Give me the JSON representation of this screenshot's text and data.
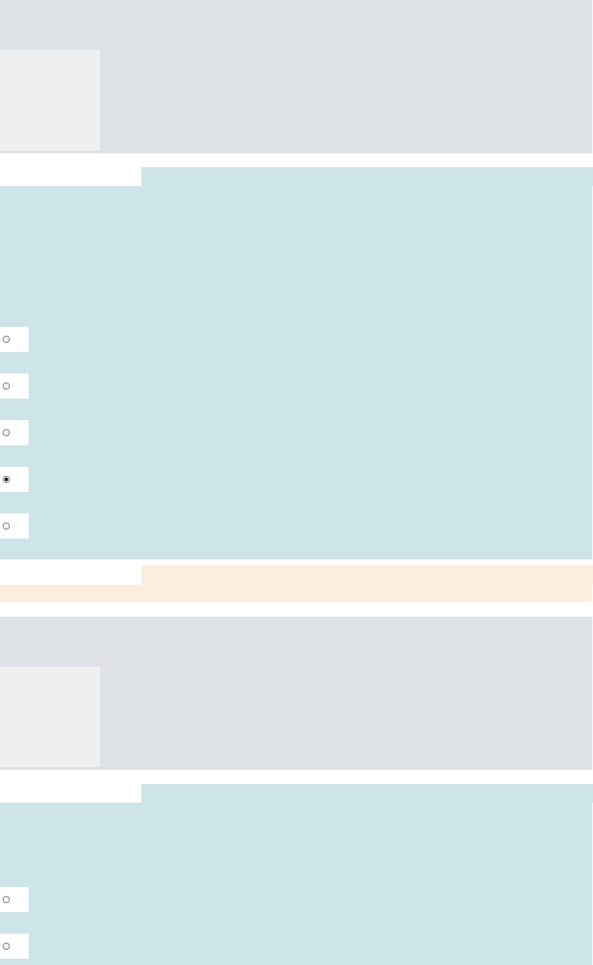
{
  "sections": [
    {
      "kind": "question",
      "options": [
        {
          "selected": false
        },
        {
          "selected": false
        },
        {
          "selected": false
        },
        {
          "selected": true
        },
        {
          "selected": false
        }
      ]
    },
    {
      "kind": "notice"
    },
    {
      "kind": "question",
      "options": [
        {
          "selected": false
        },
        {
          "selected": false
        }
      ]
    }
  ]
}
